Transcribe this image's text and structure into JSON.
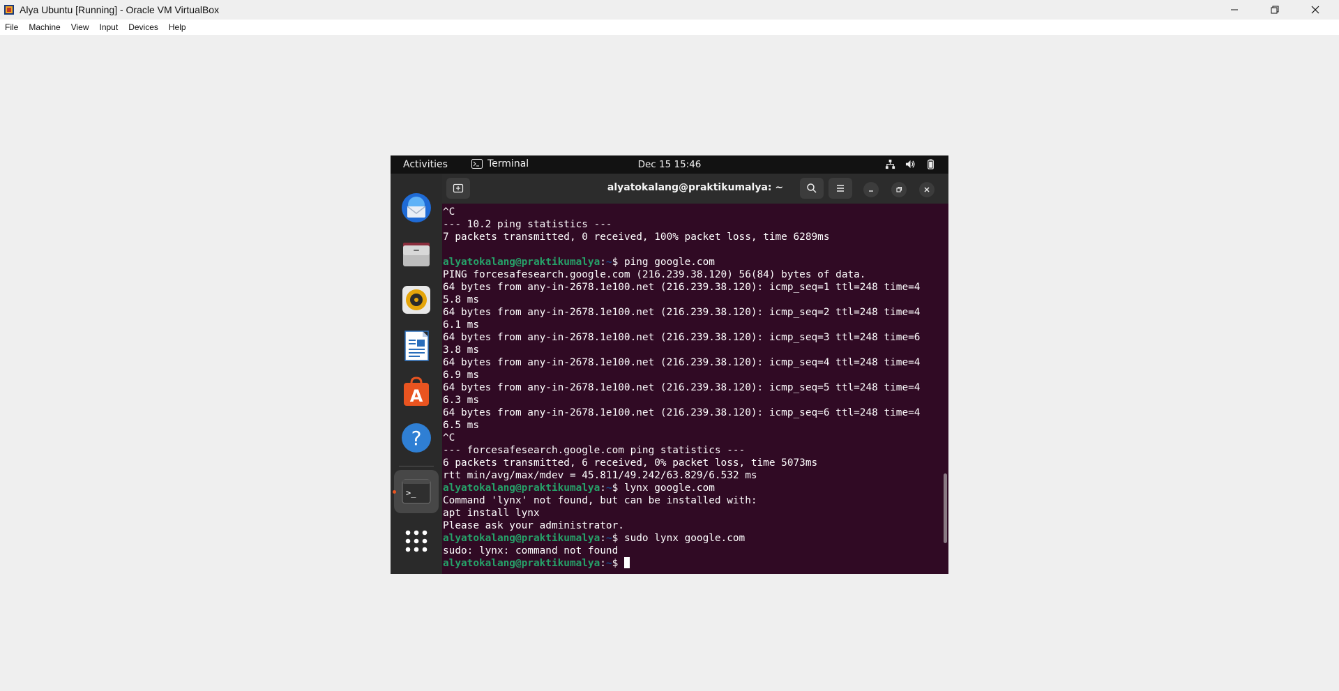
{
  "window": {
    "title": "Alya Ubuntu [Running] - Oracle VM VirtualBox"
  },
  "menu": [
    "File",
    "Machine",
    "View",
    "Input",
    "Devices",
    "Help"
  ],
  "gnome": {
    "activities": "Activities",
    "app_name": "Terminal",
    "clock": "Dec 15  15:46"
  },
  "dock": {
    "items": [
      "thunderbird-icon",
      "files-icon",
      "rhythmbox-icon",
      "libreoffice-writer-icon",
      "app-center-icon",
      "help-icon",
      "terminal-icon",
      "show-apps-icon"
    ]
  },
  "terminal": {
    "title": "alyatokalang@praktikumalya: ~",
    "lines": [
      {
        "text": "^C"
      },
      {
        "text": "--- 10.2 ping statistics ---"
      },
      {
        "text": "7 packets transmitted, 0 received, 100% packet loss, time 6289ms"
      },
      {
        "text": ""
      },
      {
        "prompt": true,
        "user": "alyatokalang@praktikumalya",
        "path": "~",
        "cmd": "ping google.com"
      },
      {
        "text": "PING forcesafesearch.google.com (216.239.38.120) 56(84) bytes of data."
      },
      {
        "text": "64 bytes from any-in-2678.1e100.net (216.239.38.120): icmp_seq=1 ttl=248 time=4"
      },
      {
        "text": "5.8 ms"
      },
      {
        "text": "64 bytes from any-in-2678.1e100.net (216.239.38.120): icmp_seq=2 ttl=248 time=4"
      },
      {
        "text": "6.1 ms"
      },
      {
        "text": "64 bytes from any-in-2678.1e100.net (216.239.38.120): icmp_seq=3 ttl=248 time=6"
      },
      {
        "text": "3.8 ms"
      },
      {
        "text": "64 bytes from any-in-2678.1e100.net (216.239.38.120): icmp_seq=4 ttl=248 time=4"
      },
      {
        "text": "6.9 ms"
      },
      {
        "text": "64 bytes from any-in-2678.1e100.net (216.239.38.120): icmp_seq=5 ttl=248 time=4"
      },
      {
        "text": "6.3 ms"
      },
      {
        "text": "64 bytes from any-in-2678.1e100.net (216.239.38.120): icmp_seq=6 ttl=248 time=4"
      },
      {
        "text": "6.5 ms"
      },
      {
        "text": "^C"
      },
      {
        "text": "--- forcesafesearch.google.com ping statistics ---"
      },
      {
        "text": "6 packets transmitted, 6 received, 0% packet loss, time 5073ms"
      },
      {
        "text": "rtt min/avg/max/mdev = 45.811/49.242/63.829/6.532 ms"
      },
      {
        "prompt": true,
        "user": "alyatokalang@praktikumalya",
        "path": "~",
        "cmd": "lynx google.com"
      },
      {
        "text": "Command 'lynx' not found, but can be installed with:"
      },
      {
        "text": "apt install lynx"
      },
      {
        "text": "Please ask your administrator."
      },
      {
        "prompt": true,
        "user": "alyatokalang@praktikumalya",
        "path": "~",
        "cmd": "sudo lynx google.com"
      },
      {
        "text": "sudo: lynx: command not found"
      },
      {
        "prompt": true,
        "user": "alyatokalang@praktikumalya",
        "path": "~",
        "cmd": "",
        "cursor": true
      }
    ]
  },
  "colors": {
    "terminal_bg": "#300a24",
    "prompt_user": "#26a269",
    "prompt_path": "#12488b",
    "ubuntu_orange": "#e95420"
  }
}
